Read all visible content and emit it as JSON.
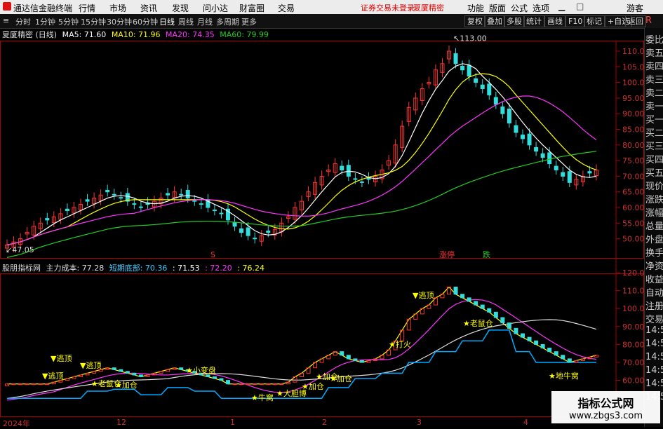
{
  "titlebar": {
    "app_name": "通达信金融终端",
    "menus": [
      "行情",
      "市场",
      "资讯",
      "发现",
      "问小达",
      "财富圈",
      "交易"
    ],
    "warning": "证券交易未登录",
    "warning2": "夏厦精密",
    "right_menus": [
      "功能",
      "版面",
      "公式",
      "选项"
    ],
    "guest": "游客"
  },
  "toolbar": {
    "periods": [
      "分时",
      "1分钟",
      "5分钟",
      "15分钟",
      "30分钟",
      "60分钟",
      "日线",
      "周线",
      "月线",
      "多周期",
      "更多"
    ],
    "selected": "日线",
    "right_buttons": [
      "复权",
      "叠加",
      "多股",
      "统计",
      "画线",
      "F10",
      "标记",
      "+自选",
      "返回"
    ]
  },
  "main_header": {
    "stock": "夏厦精密 (日线)",
    "ma5": "MA5: 71.60",
    "ma10": "MA10: 71.96",
    "ma20": "MA20: 74.35",
    "ma60": "MA60: 79.99"
  },
  "sub_header": {
    "name": "股朋指标网",
    "cost": "主力成本: 77.28",
    "short": "短期底部: 70.36",
    "v3": ": 71.53",
    "v4": ": 72.20",
    "v5": ": 76.24"
  },
  "colors": {
    "up": "#ff3333",
    "down": "#33dddd",
    "ma5": "#ffffff",
    "ma10": "#ffff00",
    "ma20": "#ff33ff",
    "ma60": "#22cc22",
    "cost": "#00aaff"
  },
  "price_axis": [
    "110.00",
    "105.00",
    "100.00",
    "95.00",
    "90.00",
    "85.00",
    "80.00",
    "75.00",
    "70.00",
    "65.00",
    "60.00",
    "55.00",
    "50.00"
  ],
  "sub_axis": [
    "120.00",
    "110.00",
    "100.00",
    "90.00",
    "80.00",
    "70.00",
    "60.00"
  ],
  "high_label": "113.00",
  "low_label": "47.05",
  "main_marks": [
    "S",
    "涨停",
    "跌"
  ],
  "signals": [
    "逃顶",
    "逃顶",
    "逃顶",
    "逃顶",
    "老鼠仓",
    "加仓",
    "加仓",
    "小变盘",
    "牛窝",
    "大胆博",
    "加仓",
    "加仓",
    "打火",
    "老鼠仓",
    "地牛窝"
  ],
  "x_labels": [
    "2024年",
    "12",
    "1",
    "2",
    "3",
    "4"
  ],
  "sidebar": {
    "r_badge": "R",
    "items": [
      "委比",
      "卖五",
      "卖四",
      "卖三",
      "卖二",
      "卖一",
      "买一",
      "买二",
      "买三",
      "买四",
      "买五",
      "现价",
      "涨跌",
      "涨幅",
      "总量",
      "外盘",
      "换手",
      "净资",
      "收益",
      "自动",
      "注册",
      "交易",
      "14:5",
      "14:5",
      "14:5",
      "14:5",
      "14:5",
      "14:5"
    ]
  },
  "watermark": {
    "line1": "指标公式网",
    "line2": "www.zbgs3.com"
  },
  "chart_data": {
    "type": "candlestick",
    "range_y": [
      47.05,
      113.0
    ],
    "closes": [
      48,
      49,
      50,
      52,
      54,
      55,
      56,
      57,
      58,
      59,
      60,
      61,
      62,
      63,
      64,
      65,
      64,
      63,
      62,
      61,
      60,
      61,
      62,
      63,
      64,
      65,
      64,
      63,
      62,
      61,
      60,
      59,
      58,
      56,
      54,
      52,
      51,
      50,
      51,
      52,
      53,
      55,
      57,
      60,
      62,
      65,
      68,
      70,
      72,
      74,
      72,
      70,
      69,
      68,
      69,
      70,
      72,
      75,
      80,
      86,
      92,
      95,
      98,
      100,
      104,
      106,
      110,
      106,
      104,
      102,
      100,
      98,
      96,
      93,
      90,
      87,
      84,
      82,
      80,
      78,
      76,
      74,
      72,
      70,
      68,
      69,
      70,
      71,
      72
    ],
    "ma_values": {
      "ma5": 71.6,
      "ma10": 71.96,
      "ma20": 74.35,
      "ma60": 79.99
    }
  }
}
